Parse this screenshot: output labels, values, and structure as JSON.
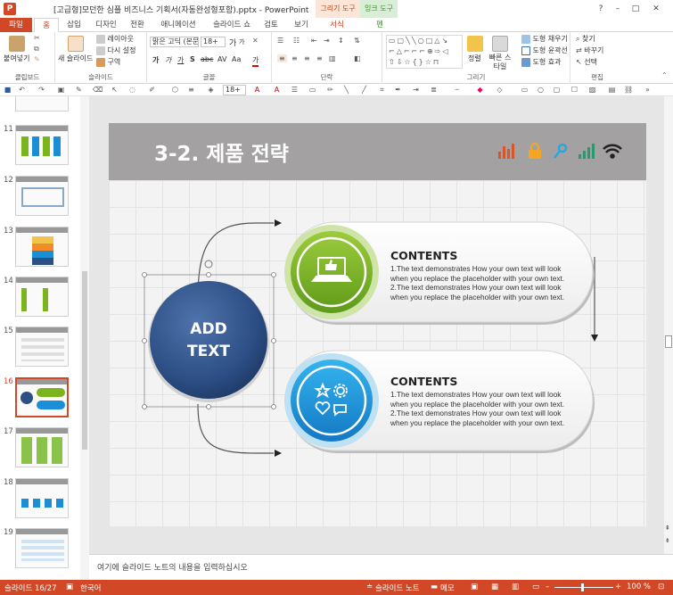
{
  "titlebar": {
    "app_icon": "P",
    "title": "[고급형]모던한 심플 비즈니스 기획서(자동완성형포함).pptx - PowerPoint",
    "context_draw": "그리기 도구",
    "context_ink": "잉크 도구",
    "help": "?",
    "minimize": "–",
    "maximize": "□",
    "close": "✕"
  },
  "tabs": [
    "파일",
    "홈",
    "삽입",
    "디자인",
    "전환",
    "애니메이션",
    "슬라이드 쇼",
    "검토",
    "보기",
    "서식",
    "펜"
  ],
  "ribbon": {
    "clipboard": {
      "paste": "붙여넣기",
      "label": "클립보드"
    },
    "slides": {
      "new_slide": "새 슬라이드",
      "layout": "레이아웃",
      "reset": "다시 설정",
      "section": "구역",
      "label": "슬라이드"
    },
    "font": {
      "font_name": "맑은 고딕 (본문",
      "font_size": "18+",
      "label": "글꼴",
      "grow": "가",
      "shrink": "가",
      "bold": "가",
      "italic": "가",
      "underline": "가",
      "shadow": "S",
      "strike": "abc",
      "spacing": "AV",
      "case": "Aa",
      "color": "가"
    },
    "paragraph": {
      "label": "단락"
    },
    "drawing": {
      "arrange": "정렬",
      "quick_styles": "빠른 스타일",
      "fill": "도형 채우기",
      "outline": "도형 윤곽선",
      "effects": "도형 효과",
      "label": "그리기"
    },
    "editing": {
      "find": "찾기",
      "replace": "바꾸기",
      "select": "선택",
      "label": "편집"
    }
  },
  "qat": {
    "font_size": "18+"
  },
  "thumbnails": [
    {
      "num": "11"
    },
    {
      "num": "12"
    },
    {
      "num": "13"
    },
    {
      "num": "14"
    },
    {
      "num": "15"
    },
    {
      "num": "16"
    },
    {
      "num": "17"
    },
    {
      "num": "18"
    },
    {
      "num": "19"
    }
  ],
  "active_slide": "16",
  "slide": {
    "title": "3-2. 제품 전략",
    "circle_text_1": "ADD",
    "circle_text_2": "TEXT",
    "card1": {
      "title": "CONTENTS",
      "lines": [
        "1.The text demonstrates How your own text will look",
        "when you replace the placeholder with your own text.",
        "2.The text demonstrates How your own text will look",
        "when you replace the placeholder with your own text."
      ]
    },
    "card2": {
      "title": "CONTENTS",
      "lines": [
        "1.The text demonstrates How your own text will look",
        "when you replace the placeholder with your own text.",
        "2.The text demonstrates How your own text will look",
        "when you replace the placeholder with your own text."
      ]
    }
  },
  "notes_placeholder": "여기에 슬라이드 노트의 내용을 입력하십시오",
  "status": {
    "slide": "슬라이드 16/27",
    "lang": "한국어",
    "notes": "슬라이드 노트",
    "comments": "메모",
    "zoom": "100 %"
  },
  "colors": {
    "accent": "#d24726",
    "green": "#7ab51d",
    "blue": "#1a8fd6",
    "navy": "#2d4f86"
  }
}
